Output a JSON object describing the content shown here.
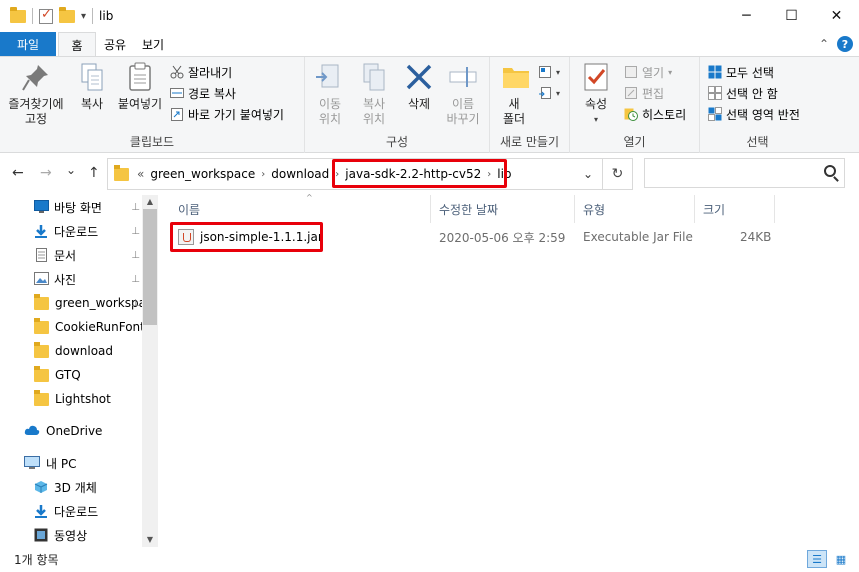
{
  "window": {
    "title": "lib",
    "minimize": "─",
    "maximize": "☐",
    "close": "✕",
    "qa_dropdown": "▾"
  },
  "tabs": {
    "file": "파일",
    "items": [
      "홈",
      "공유",
      "보기"
    ],
    "collapse": "⌃",
    "help": "?"
  },
  "ribbon": {
    "clipboard": {
      "label": "클립보드",
      "pin": "즐겨찾기에\n고정",
      "copy": "복사",
      "paste": "붙여넣기",
      "cut": "잘라내기",
      "copy_path": "경로 복사",
      "paste_shortcut": "바로 가기 붙여넣기"
    },
    "organize": {
      "label": "구성",
      "move_to": "이동\n위치",
      "copy_to": "복사\n위치",
      "delete": "삭제",
      "rename": "이름\n바꾸기"
    },
    "new": {
      "label": "새로 만들기",
      "new_folder": "새\n폴더"
    },
    "open": {
      "label": "열기",
      "properties": "속성",
      "open": "열기",
      "edit": "편집",
      "history": "히스토리"
    },
    "select": {
      "label": "선택",
      "select_all": "모두 선택",
      "select_none": "선택 안 함",
      "invert": "선택 영역 반전"
    }
  },
  "nav": {
    "back": "←",
    "forward": "→",
    "recent": "⌄",
    "up": "↑"
  },
  "address": {
    "overflow": "«",
    "crumbs": [
      "green_workspace",
      "download",
      "java-sdk-2.2-http-cv52",
      "lib"
    ],
    "separator": "›",
    "dropdown": "⌄",
    "refresh": "↻"
  },
  "search": {
    "placeholder": ""
  },
  "sidebar": {
    "quick_access": [
      {
        "label": "바탕 화면",
        "pinned": true
      },
      {
        "label": "다운로드",
        "pinned": true
      },
      {
        "label": "문서",
        "pinned": true
      },
      {
        "label": "사진",
        "pinned": true
      },
      {
        "label": "green_workspa",
        "pinned": true
      },
      {
        "label": "CookieRunFont_",
        "pinned": false
      },
      {
        "label": "download",
        "pinned": false
      },
      {
        "label": "GTQ",
        "pinned": false
      },
      {
        "label": "Lightshot",
        "pinned": false
      }
    ],
    "onedrive": "OneDrive",
    "this_pc": "내 PC",
    "pc_items": [
      "3D 개체",
      "다운로드",
      "동영상"
    ],
    "pin_glyph": "📌",
    "scroll_up": "▲",
    "scroll_down": "▼"
  },
  "columns": {
    "name": "이름",
    "modified": "수정한 날짜",
    "type": "유형",
    "size": "크기",
    "sort": "^"
  },
  "files": [
    {
      "name": "json-simple-1.1.1.jar",
      "modified": "2020-05-06 오후 2:59",
      "type": "Executable Jar File",
      "size": "24KB"
    }
  ],
  "status": {
    "count": "1개 항목"
  },
  "colors": {
    "accent": "#1979ca",
    "highlight": "#e8000a"
  }
}
